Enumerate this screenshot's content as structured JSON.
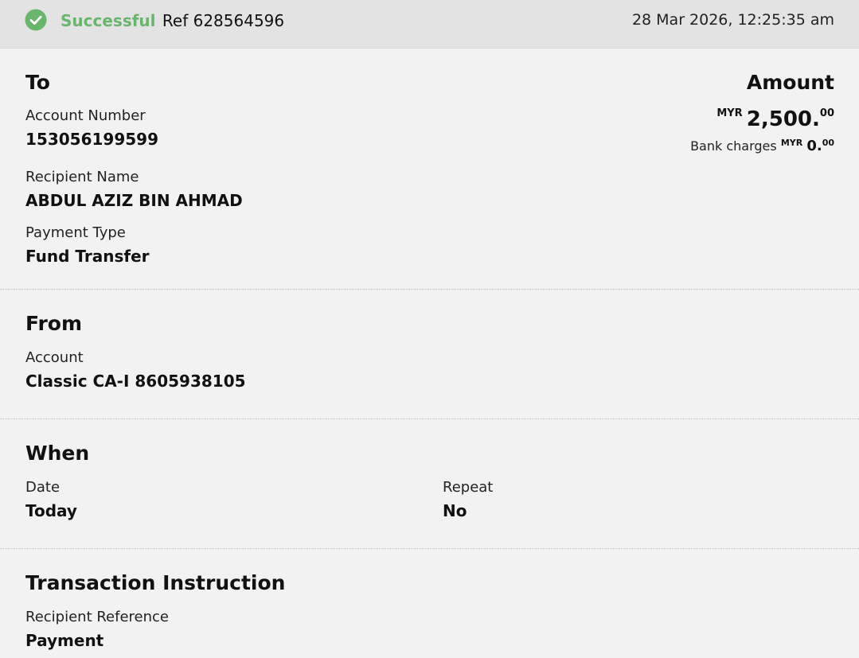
{
  "status": {
    "text": "Successful",
    "ref_label": "Ref",
    "ref_number": "628564596",
    "timestamp": "28 Mar 2026, 12:25:35 am",
    "accent_color": "#6ab56e"
  },
  "to_section": {
    "heading": "To",
    "account_number_label": "Account Number",
    "account_number": "153056199599",
    "recipient_name_label": "Recipient Name",
    "recipient_name": "ABDUL AZIZ BIN AHMAD",
    "payment_type_label": "Payment Type",
    "payment_type": "Fund Transfer"
  },
  "amount": {
    "heading": "Amount",
    "currency": "MYR",
    "whole": "2,500.",
    "decimals": "00",
    "bank_charges_label": "Bank charges",
    "bank_charges_currency": "MYR",
    "bank_charges_whole": "0.",
    "bank_charges_decimals": "00"
  },
  "from_section": {
    "heading": "From",
    "account_label": "Account",
    "account": "Classic CA-I 8605938105"
  },
  "when_section": {
    "heading": "When",
    "date_label": "Date",
    "date": "Today",
    "repeat_label": "Repeat",
    "repeat": "No"
  },
  "instruction_section": {
    "heading": "Transaction Instruction",
    "recipient_reference_label": "Recipient Reference",
    "recipient_reference": "Payment"
  },
  "icons": {
    "status": "check-circle-icon"
  }
}
